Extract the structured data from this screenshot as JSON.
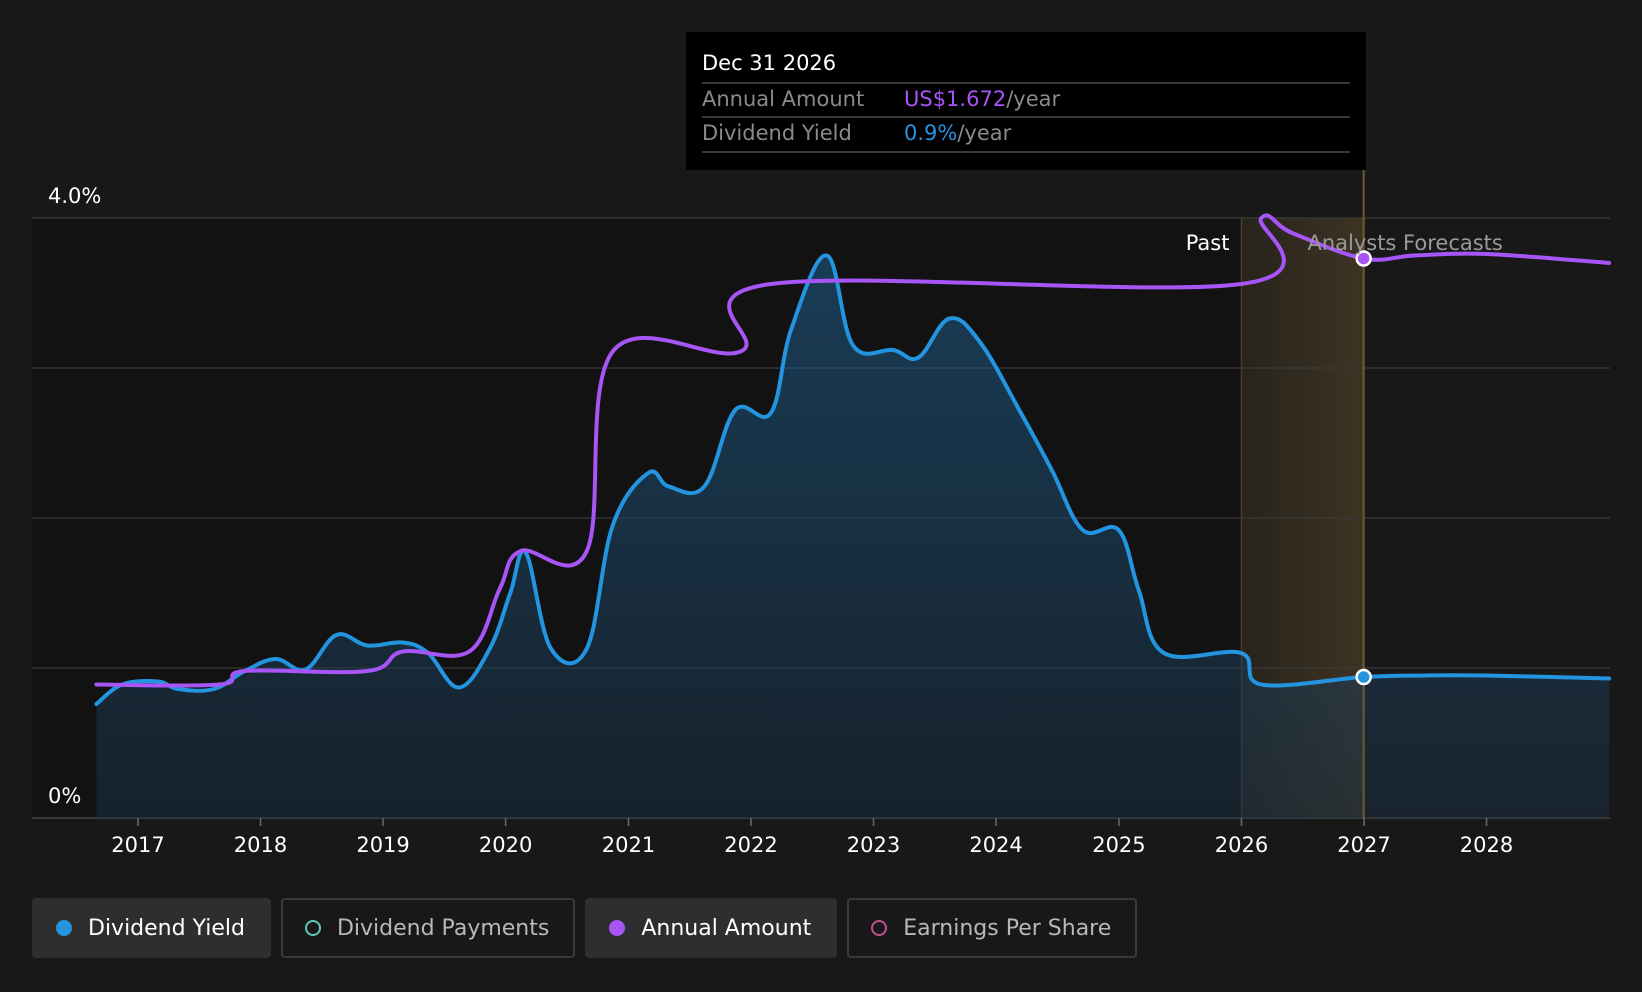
{
  "tooltip": {
    "date": "Dec 31 2026",
    "rows": [
      {
        "label": "Annual Amount",
        "value": "US$1.672",
        "unit": "/year",
        "color": "#a855f7"
      },
      {
        "label": "Dividend Yield",
        "value": "0.9%",
        "unit": "/year",
        "color": "#2394df"
      }
    ]
  },
  "regions": {
    "past_label": "Past",
    "forecast_label": "Analysts Forecasts"
  },
  "legend": [
    {
      "label": "Dividend Yield",
      "color": "#2394df",
      "style": "filled",
      "active": true
    },
    {
      "label": "Dividend Payments",
      "color": "#5ec8b8",
      "style": "ring",
      "active": false
    },
    {
      "label": "Annual Amount",
      "color": "#a855f7",
      "style": "filled",
      "active": true
    },
    {
      "label": "Earnings Per Share",
      "color": "#c0508a",
      "style": "ring",
      "active": false
    }
  ],
  "colors": {
    "background": "#181818",
    "past_panel": "#121212",
    "grid": "#3a3a3a",
    "yield": "#2394df",
    "annual": "#a855f7",
    "forecast_band": "#6b5530"
  },
  "chart_data": {
    "type": "line",
    "x_axis_type": "date",
    "y_tick_labels": [
      "0%",
      "4.0%"
    ],
    "x_tick_labels": [
      "2017",
      "2018",
      "2019",
      "2020",
      "2021",
      "2022",
      "2023",
      "2024",
      "2025",
      "2026",
      "2027",
      "2028"
    ],
    "ylim": [
      0,
      4.0
    ],
    "xlim": [
      "2016-03-15",
      "2028-12-31"
    ],
    "grid": true,
    "legend_position": "bottom",
    "past_end": "2026-01-01",
    "forecast_band": [
      "2026-01-01",
      "2026-12-31"
    ],
    "highlight_date": "2026-12-31",
    "series": [
      {
        "name": "Dividend Yield",
        "unit": "%",
        "area": true,
        "points": [
          [
            "2016-08-30",
            0.76
          ],
          [
            "2016-11-15",
            0.89
          ],
          [
            "2017-03-01",
            0.91
          ],
          [
            "2017-05-01",
            0.86
          ],
          [
            "2017-08-15",
            0.86
          ],
          [
            "2017-11-15",
            0.98
          ],
          [
            "2018-02-15",
            1.06
          ],
          [
            "2018-05-15",
            0.99
          ],
          [
            "2018-08-15",
            1.22
          ],
          [
            "2018-11-15",
            1.15
          ],
          [
            "2019-03-01",
            1.17
          ],
          [
            "2019-05-15",
            1.1
          ],
          [
            "2019-08-15",
            0.87
          ],
          [
            "2019-11-15",
            1.13
          ],
          [
            "2020-01-15",
            1.5
          ],
          [
            "2020-03-01",
            1.77
          ],
          [
            "2020-05-15",
            1.13
          ],
          [
            "2020-08-30",
            1.13
          ],
          [
            "2020-11-15",
            1.95
          ],
          [
            "2021-03-01",
            2.3
          ],
          [
            "2021-05-01",
            2.21
          ],
          [
            "2021-08-15",
            2.21
          ],
          [
            "2021-11-15",
            2.72
          ],
          [
            "2022-03-01",
            2.7
          ],
          [
            "2022-05-01",
            3.26
          ],
          [
            "2022-08-15",
            3.75
          ],
          [
            "2022-11-01",
            3.15
          ],
          [
            "2023-03-01",
            3.12
          ],
          [
            "2023-05-15",
            3.07
          ],
          [
            "2023-08-15",
            3.33
          ],
          [
            "2023-11-15",
            3.17
          ],
          [
            "2024-03-15",
            2.7
          ],
          [
            "2024-06-15",
            2.32
          ],
          [
            "2024-09-15",
            1.92
          ],
          [
            "2024-12-31",
            1.92
          ],
          [
            "2025-03-01",
            1.52
          ],
          [
            "2025-05-15",
            1.1
          ],
          [
            "2025-12-31",
            1.1
          ],
          [
            "2026-03-01",
            0.89
          ],
          [
            "2026-12-31",
            0.94
          ],
          [
            "2027-06-30",
            0.95
          ],
          [
            "2028-01-01",
            0.95
          ],
          [
            "2028-12-31",
            0.93
          ]
        ]
      },
      {
        "name": "Annual Amount",
        "unit": "US$",
        "area": false,
        "points": [
          [
            "2016-08-30",
            0.89
          ],
          [
            "2017-09-01",
            0.89
          ],
          [
            "2017-11-15",
            0.98
          ],
          [
            "2018-11-15",
            0.98
          ],
          [
            "2019-03-01",
            1.11
          ],
          [
            "2019-09-15",
            1.11
          ],
          [
            "2019-12-15",
            1.53
          ],
          [
            "2020-02-15",
            1.78
          ],
          [
            "2020-08-30",
            1.78
          ],
          [
            "2020-11-15",
            3.11
          ],
          [
            "2021-12-01",
            3.11
          ],
          [
            "2022-03-01",
            3.56
          ],
          [
            "2025-12-31",
            3.56
          ],
          [
            "2026-03-01",
            4.0
          ],
          [
            "2026-06-01",
            3.9
          ],
          [
            "2026-12-31",
            3.73
          ],
          [
            "2027-06-01",
            3.75
          ],
          [
            "2028-01-01",
            3.76
          ],
          [
            "2028-12-31",
            3.7
          ]
        ]
      }
    ]
  }
}
